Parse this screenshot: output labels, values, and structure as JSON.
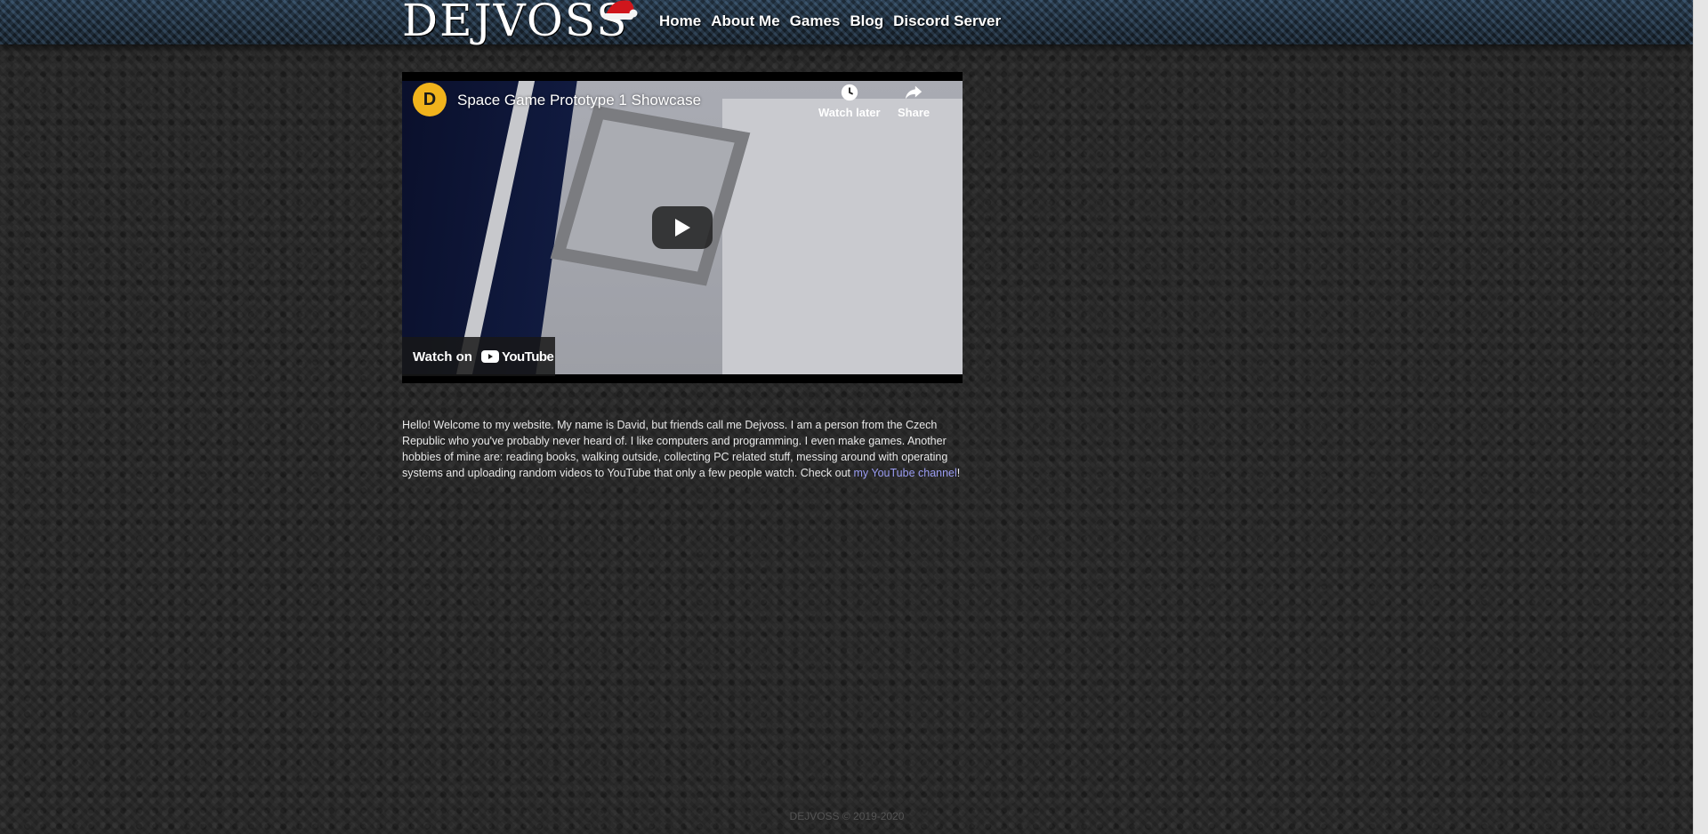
{
  "site": {
    "logo": "DEJVOSS"
  },
  "nav": {
    "items": [
      "Home",
      "About Me",
      "Games",
      "Blog",
      "Discord Server"
    ]
  },
  "video": {
    "channel_initial": "D",
    "title": "Space Game Prototype 1 Showcase",
    "watch_later_label": "Watch later",
    "share_label": "Share",
    "watch_on_label": "Watch on",
    "youtube_label": "YouTube"
  },
  "intro": {
    "text": "Hello! Welcome to my website. My name is David, but friends call me Dejvoss. I am a person from the Czech Republic who you've probably never heard of. I like computers and programming. I even make games. Another hobbies of mine are: reading books, walking outside, collecting PC related stuff, messing around with operating systems and uploading random videos to YouTube that only a few people watch. Check out ",
    "link_text": "my YouTube channel",
    "after_link": "!"
  },
  "footer": {
    "text": "DEJVOSS © 2019-2020"
  },
  "colors": {
    "link": "#9a9cf2",
    "avatar": "#f1b31c"
  }
}
